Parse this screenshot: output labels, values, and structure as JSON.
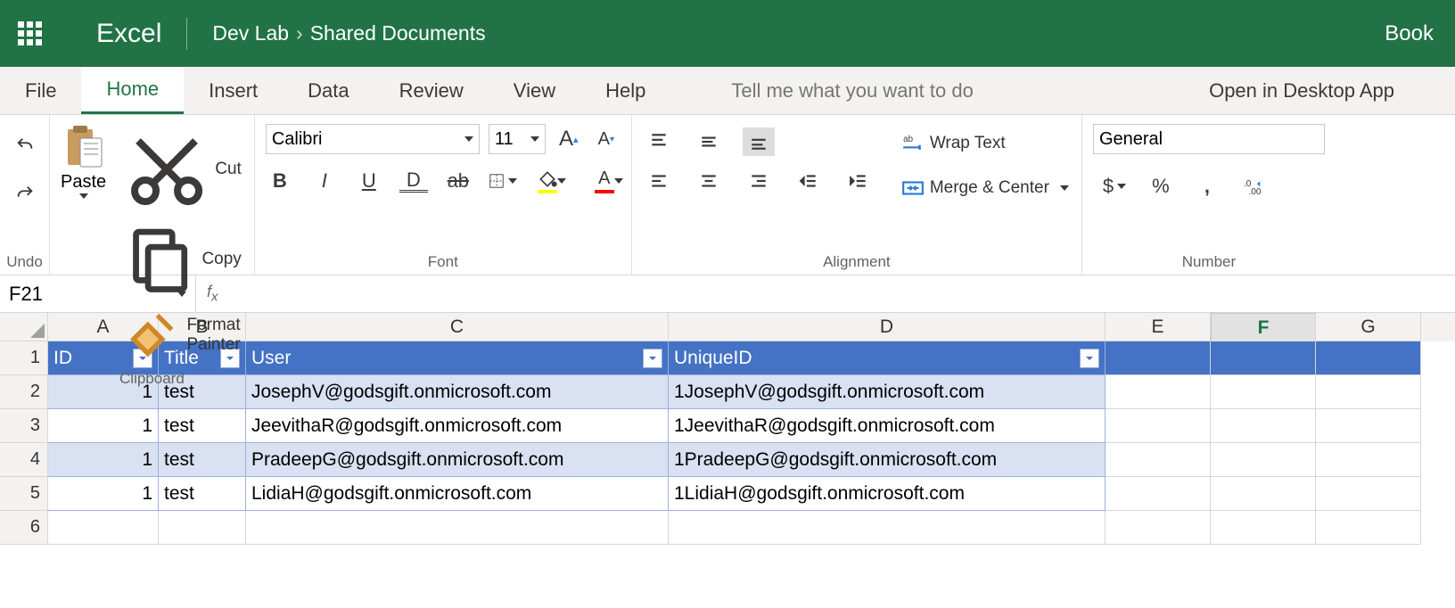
{
  "titlebar": {
    "app": "Excel",
    "crumb1": "Dev Lab",
    "crumb2": "Shared Documents",
    "doc": "Book"
  },
  "tabs": {
    "file": "File",
    "home": "Home",
    "insert": "Insert",
    "data": "Data",
    "review": "Review",
    "view": "View",
    "help": "Help",
    "tellme": "Tell me what you want to do",
    "desktop": "Open in Desktop App"
  },
  "ribbon": {
    "undo": "Undo",
    "paste": "Paste",
    "cut": "Cut",
    "copy": "Copy",
    "format_painter": "Format Painter",
    "clipboard": "Clipboard",
    "font_name": "Calibri",
    "font_size": "11",
    "font": "Font",
    "wrap": "Wrap Text",
    "merge": "Merge & Center",
    "alignment": "Alignment",
    "number_fmt": "General",
    "number": "Number"
  },
  "namebox": {
    "cell": "F21",
    "formula": ""
  },
  "columns": [
    "A",
    "B",
    "C",
    "D",
    "E",
    "F",
    "G"
  ],
  "headers": {
    "id": "ID",
    "title": "Title",
    "user": "User",
    "uniqueid": "UniqueID"
  },
  "rows": [
    {
      "id": "1",
      "title": "test",
      "user": "JosephV@godsgift.onmicrosoft.com",
      "uniqueid": "1JosephV@godsgift.onmicrosoft.com"
    },
    {
      "id": "1",
      "title": "test",
      "user": "JeevithaR@godsgift.onmicrosoft.com",
      "uniqueid": "1JeevithaR@godsgift.onmicrosoft.com"
    },
    {
      "id": "1",
      "title": "test",
      "user": "PradeepG@godsgift.onmicrosoft.com",
      "uniqueid": "1PradeepG@godsgift.onmicrosoft.com"
    },
    {
      "id": "1",
      "title": "test",
      "user": "LidiaH@godsgift.onmicrosoft.com",
      "uniqueid": "1LidiaH@godsgift.onmicrosoft.com"
    }
  ]
}
